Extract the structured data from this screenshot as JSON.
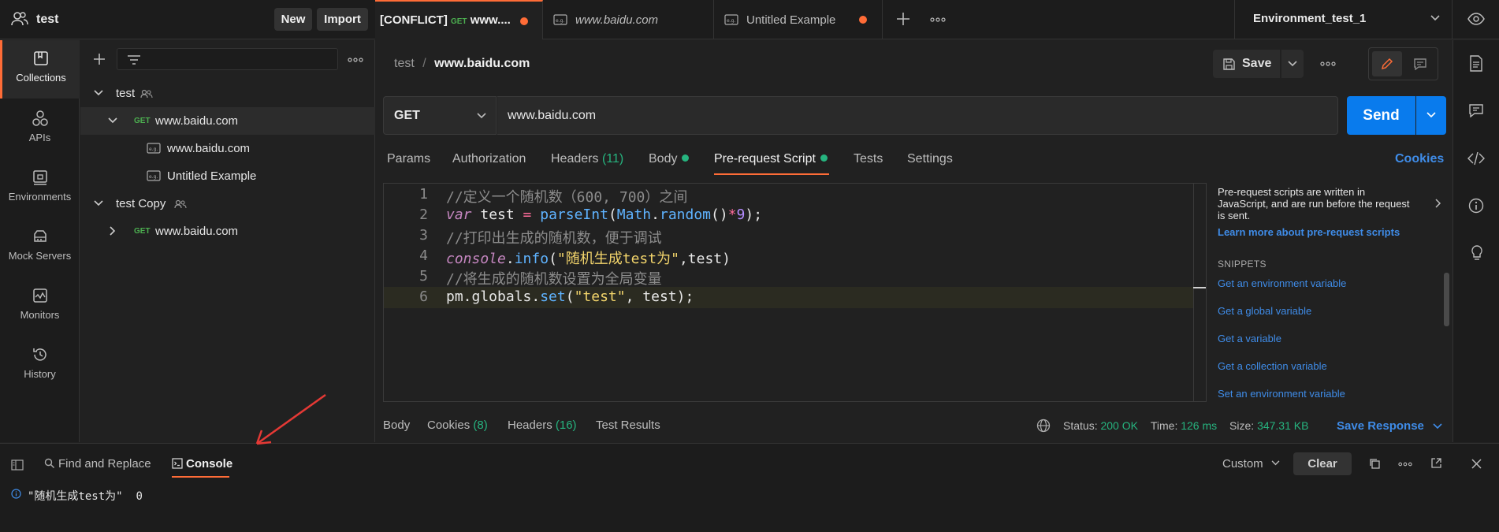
{
  "workspace": {
    "name": "test",
    "new_label": "New",
    "import_label": "Import"
  },
  "tabs": [
    {
      "prefix": "[CONFLICT]",
      "method": "GET",
      "label": "www...."
    },
    {
      "label": "www.baidu.com"
    },
    {
      "label": "Untitled Example"
    }
  ],
  "environment": {
    "selected": "Environment_test_1"
  },
  "rail": [
    {
      "label": "Collections",
      "icon": "collections-icon"
    },
    {
      "label": "APIs",
      "icon": "apis-icon"
    },
    {
      "label": "Environments",
      "icon": "environments-icon"
    },
    {
      "label": "Mock Servers",
      "icon": "mock-servers-icon"
    },
    {
      "label": "Monitors",
      "icon": "monitors-icon"
    },
    {
      "label": "History",
      "icon": "history-icon"
    }
  ],
  "tree": [
    {
      "label": "test"
    },
    {
      "method": "GET",
      "label": "www.baidu.com"
    },
    {
      "label": "www.baidu.com"
    },
    {
      "label": "Untitled Example"
    },
    {
      "label": "test Copy"
    },
    {
      "method": "GET",
      "label": "www.baidu.com"
    }
  ],
  "request": {
    "breadcrumb_parent": "test",
    "breadcrumb_sep": "/",
    "breadcrumb_current": "www.baidu.com",
    "save_label": "Save",
    "method": "GET",
    "url": "www.baidu.com",
    "send_label": "Send",
    "cookies_label": "Cookies"
  },
  "subtabs": {
    "params": "Params",
    "authorization": "Authorization",
    "headers": "Headers",
    "headers_count": "(11)",
    "body": "Body",
    "prerequest": "Pre-request Script",
    "tests": "Tests",
    "settings": "Settings"
  },
  "code_lines": [
    "1",
    "2",
    "3",
    "4",
    "5",
    "6"
  ],
  "code": {
    "l1": "//定义一个随机数（600, 700）之间",
    "l2_kw": "var",
    "l2_a": " test ",
    "l2_op": "=",
    "l2_fn": " parseInt",
    "l2_b": "(",
    "l2_obj": "Math",
    "l2_c": ".",
    "l2_fn2": "random",
    "l2_d": "()",
    "l2_op2": "*",
    "l2_num": "9",
    "l2_e": ");",
    "l3": "//打印出生成的随机数，便于调试",
    "l4_kw": "console",
    "l4_a": ".",
    "l4_fn": "info",
    "l4_b": "(",
    "l4_str": "\"随机生成test为\"",
    "l4_c": ",test)",
    "l5": "//将生成的随机数设置为全局变量",
    "l6_a": "pm.globals.",
    "l6_fn": "set",
    "l6_b": "(",
    "l6_str": "\"test\"",
    "l6_c": ", test);"
  },
  "help": {
    "text": "Pre-request scripts are written in JavaScript, and are run before the request is sent.",
    "learn_more": "Learn more about pre-request scripts",
    "snippets_title": "SNIPPETS",
    "snippets": [
      "Get an environment variable",
      "Get a global variable",
      "Get a variable",
      "Get a collection variable",
      "Set an environment variable"
    ]
  },
  "response": {
    "body": "Body",
    "cookies": "Cookies",
    "cookies_count": "(8)",
    "headers": "Headers",
    "headers_count": "(16)",
    "test_results": "Test Results",
    "status_label": "Status:",
    "status_value": "200 OK",
    "time_label": "Time:",
    "time_value": "126 ms",
    "size_label": "Size:",
    "size_value": "347.31 KB",
    "save_response": "Save Response"
  },
  "bottom": {
    "find_replace": "Find and Replace",
    "console": "Console",
    "custom": "Custom",
    "clear": "Clear",
    "log_text": "\"随机生成test为\"",
    "log_value": "0"
  },
  "colors": {
    "accent": "#ff6c37",
    "send": "#097bed",
    "link": "#3f8ce8",
    "green": "#26b47f"
  }
}
